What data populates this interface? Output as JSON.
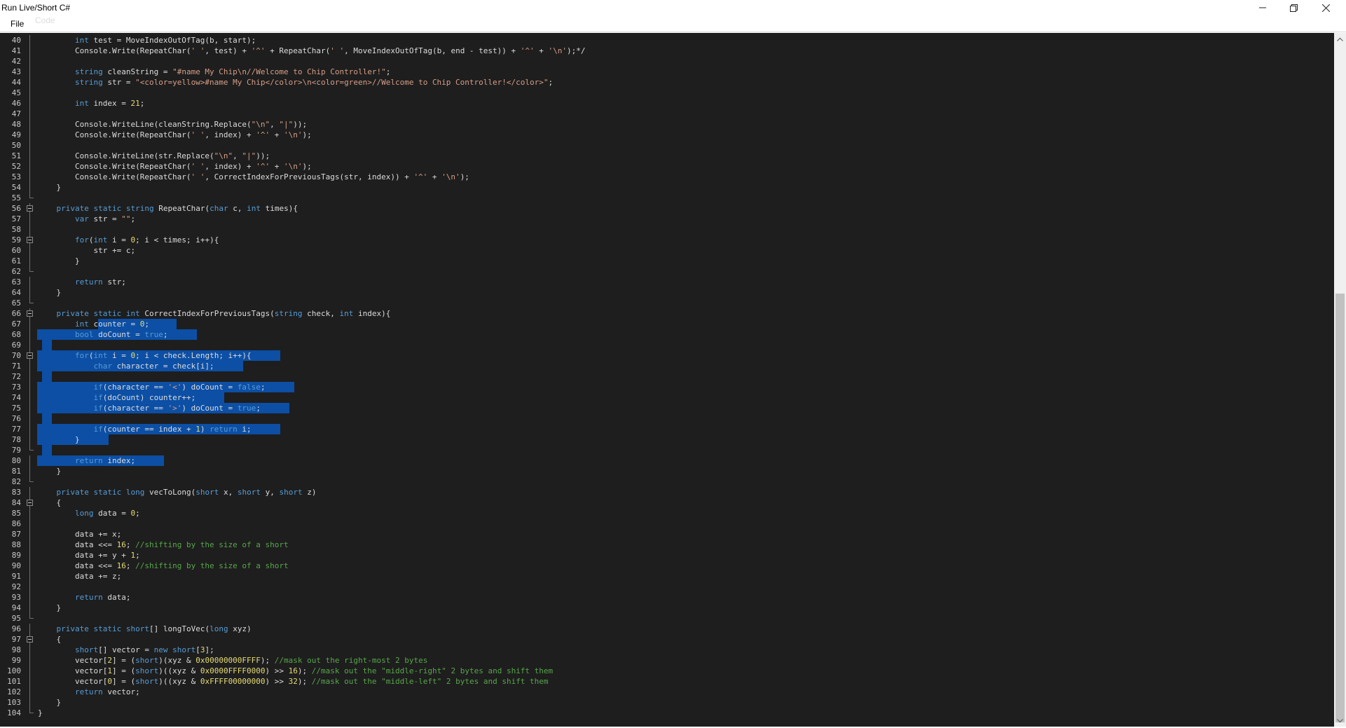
{
  "window": {
    "title": "Run Live/Short C#"
  },
  "menu": {
    "items": [
      "File",
      "Code"
    ]
  },
  "editor": {
    "selection_lines": [
      67,
      80
    ],
    "lines": [
      {
        "n": "40",
        "fold": "v",
        "t": "        int test = MoveIndexOutOfTag(b, start);"
      },
      {
        "n": "41",
        "fold": "v",
        "t": "        Console.Write(RepeatChar(' ', test) + '^' + RepeatChar(' ', MoveIndexOutOfTag(b, end - test)) + '^' + '\\n');*/"
      },
      {
        "n": "42",
        "fold": "v",
        "t": ""
      },
      {
        "n": "43",
        "fold": "v",
        "t": "        string cleanString = \"#name My Chip\\n//Welcome to Chip Controller!\";"
      },
      {
        "n": "44",
        "fold": "v",
        "t": "        string str = \"<color=yellow>#name My Chip</color>\\n<color=green>//Welcome to Chip Controller!</color>\";"
      },
      {
        "n": "45",
        "fold": "v",
        "t": ""
      },
      {
        "n": "46",
        "fold": "v",
        "t": "        int index = 21;"
      },
      {
        "n": "47",
        "fold": "v",
        "t": ""
      },
      {
        "n": "48",
        "fold": "v",
        "t": "        Console.WriteLine(cleanString.Replace(\"\\n\", \"|\"));"
      },
      {
        "n": "49",
        "fold": "v",
        "t": "        Console.Write(RepeatChar(' ', index) + '^' + '\\n');"
      },
      {
        "n": "50",
        "fold": "v",
        "t": ""
      },
      {
        "n": "51",
        "fold": "v",
        "t": "        Console.WriteLine(str.Replace(\"\\n\", \"|\"));"
      },
      {
        "n": "52",
        "fold": "v",
        "t": "        Console.Write(RepeatChar(' ', index) + '^' + '\\n');"
      },
      {
        "n": "53",
        "fold": "v",
        "t": "        Console.Write(RepeatChar(' ', CorrectIndexForPreviousTags(str, index)) + '^' + '\\n');"
      },
      {
        "n": "54",
        "fold": "v",
        "t": "    }"
      },
      {
        "n": "55",
        "fold": "e",
        "t": ""
      },
      {
        "n": "56",
        "fold": "b",
        "t": "    private static string RepeatChar(char c, int times){"
      },
      {
        "n": "57",
        "fold": "v",
        "t": "        var str = \"\";"
      },
      {
        "n": "58",
        "fold": "v",
        "t": ""
      },
      {
        "n": "59",
        "fold": "b",
        "t": "        for(int i = 0; i < times; i++){"
      },
      {
        "n": "60",
        "fold": "v",
        "t": "            str += c;"
      },
      {
        "n": "61",
        "fold": "v",
        "t": "        }"
      },
      {
        "n": "62",
        "fold": "e",
        "t": ""
      },
      {
        "n": "63",
        "fold": "v",
        "t": "        return str;"
      },
      {
        "n": "64",
        "fold": "v",
        "t": "    }"
      },
      {
        "n": "65",
        "fold": "e",
        "t": ""
      },
      {
        "n": "66",
        "fold": "b",
        "t": "    private static int CorrectIndexForPreviousTags(string check, int index){"
      },
      {
        "n": "67",
        "fold": "v",
        "t": "        int counter = 0;"
      },
      {
        "n": "68",
        "fold": "v",
        "t": "        bool doCount = true;"
      },
      {
        "n": "69",
        "fold": "v",
        "t": ""
      },
      {
        "n": "70",
        "fold": "b",
        "t": "        for(int i = 0; i < check.Length; i++){"
      },
      {
        "n": "71",
        "fold": "v",
        "t": "            char character = check[i];"
      },
      {
        "n": "72",
        "fold": "v",
        "t": ""
      },
      {
        "n": "73",
        "fold": "v",
        "t": "            if(character == '<') doCount = false;"
      },
      {
        "n": "74",
        "fold": "v",
        "t": "            if(doCount) counter++;"
      },
      {
        "n": "75",
        "fold": "v",
        "t": "            if(character == '>') doCount = true;"
      },
      {
        "n": "76",
        "fold": "v",
        "t": ""
      },
      {
        "n": "77",
        "fold": "v",
        "t": "            if(counter == index + 1) return i;"
      },
      {
        "n": "78",
        "fold": "v",
        "t": "        }"
      },
      {
        "n": "79",
        "fold": "e",
        "t": ""
      },
      {
        "n": "80",
        "fold": "v",
        "t": "        return index;"
      },
      {
        "n": "81",
        "fold": "v",
        "t": "    }"
      },
      {
        "n": "82",
        "fold": "e",
        "t": ""
      },
      {
        "n": "83",
        "fold": "v",
        "t": "    private static long vecToLong(short x, short y, short z)"
      },
      {
        "n": "84",
        "fold": "b",
        "t": "    {"
      },
      {
        "n": "85",
        "fold": "v",
        "t": "        long data = 0;"
      },
      {
        "n": "86",
        "fold": "v",
        "t": ""
      },
      {
        "n": "87",
        "fold": "v",
        "t": "        data += x;"
      },
      {
        "n": "88",
        "fold": "v",
        "t": "        data <<= 16; //shifting by the size of a short"
      },
      {
        "n": "89",
        "fold": "v",
        "t": "        data += y + 1;"
      },
      {
        "n": "90",
        "fold": "v",
        "t": "        data <<= 16; //shifting by the size of a short"
      },
      {
        "n": "91",
        "fold": "v",
        "t": "        data += z;"
      },
      {
        "n": "92",
        "fold": "v",
        "t": ""
      },
      {
        "n": "93",
        "fold": "v",
        "t": "        return data;"
      },
      {
        "n": "94",
        "fold": "v",
        "t": "    }"
      },
      {
        "n": "95",
        "fold": "e",
        "t": ""
      },
      {
        "n": "96",
        "fold": "v",
        "t": "    private static short[] longToVec(long xyz)"
      },
      {
        "n": "97",
        "fold": "b",
        "t": "    {"
      },
      {
        "n": "98",
        "fold": "v",
        "t": "        short[] vector = new short[3];"
      },
      {
        "n": "99",
        "fold": "v",
        "t": "        vector[2] = (short)(xyz & 0x00000000FFFF); //mask out the right-most 2 bytes"
      },
      {
        "n": "100",
        "fold": "v",
        "t": "        vector[1] = (short)((xyz & 0x0000FFFF0000) >> 16); //mask out the \"middle-right\" 2 bytes and shift them"
      },
      {
        "n": "101",
        "fold": "v",
        "t": "        vector[0] = (short)((xyz & 0xFFFF00000000) >> 32); //mask out the \"middle-left\" 2 bytes and shift them"
      },
      {
        "n": "102",
        "fold": "v",
        "t": "        return vector;"
      },
      {
        "n": "103",
        "fold": "v",
        "t": "    }"
      },
      {
        "n": "104",
        "fold": "e",
        "t": "}"
      }
    ]
  },
  "colors": {
    "editor_bg": "#1e1e1e",
    "keyword": "#569cd6",
    "string": "#d69d85",
    "comment": "#57a64a",
    "number": "#e6db74",
    "selection": "#0c4fa5"
  },
  "icons": [
    "minimize-icon",
    "maximize-icon",
    "close-icon",
    "fold-collapse-icon",
    "scroll-up-arrow-icon",
    "scroll-down-arrow-icon"
  ]
}
